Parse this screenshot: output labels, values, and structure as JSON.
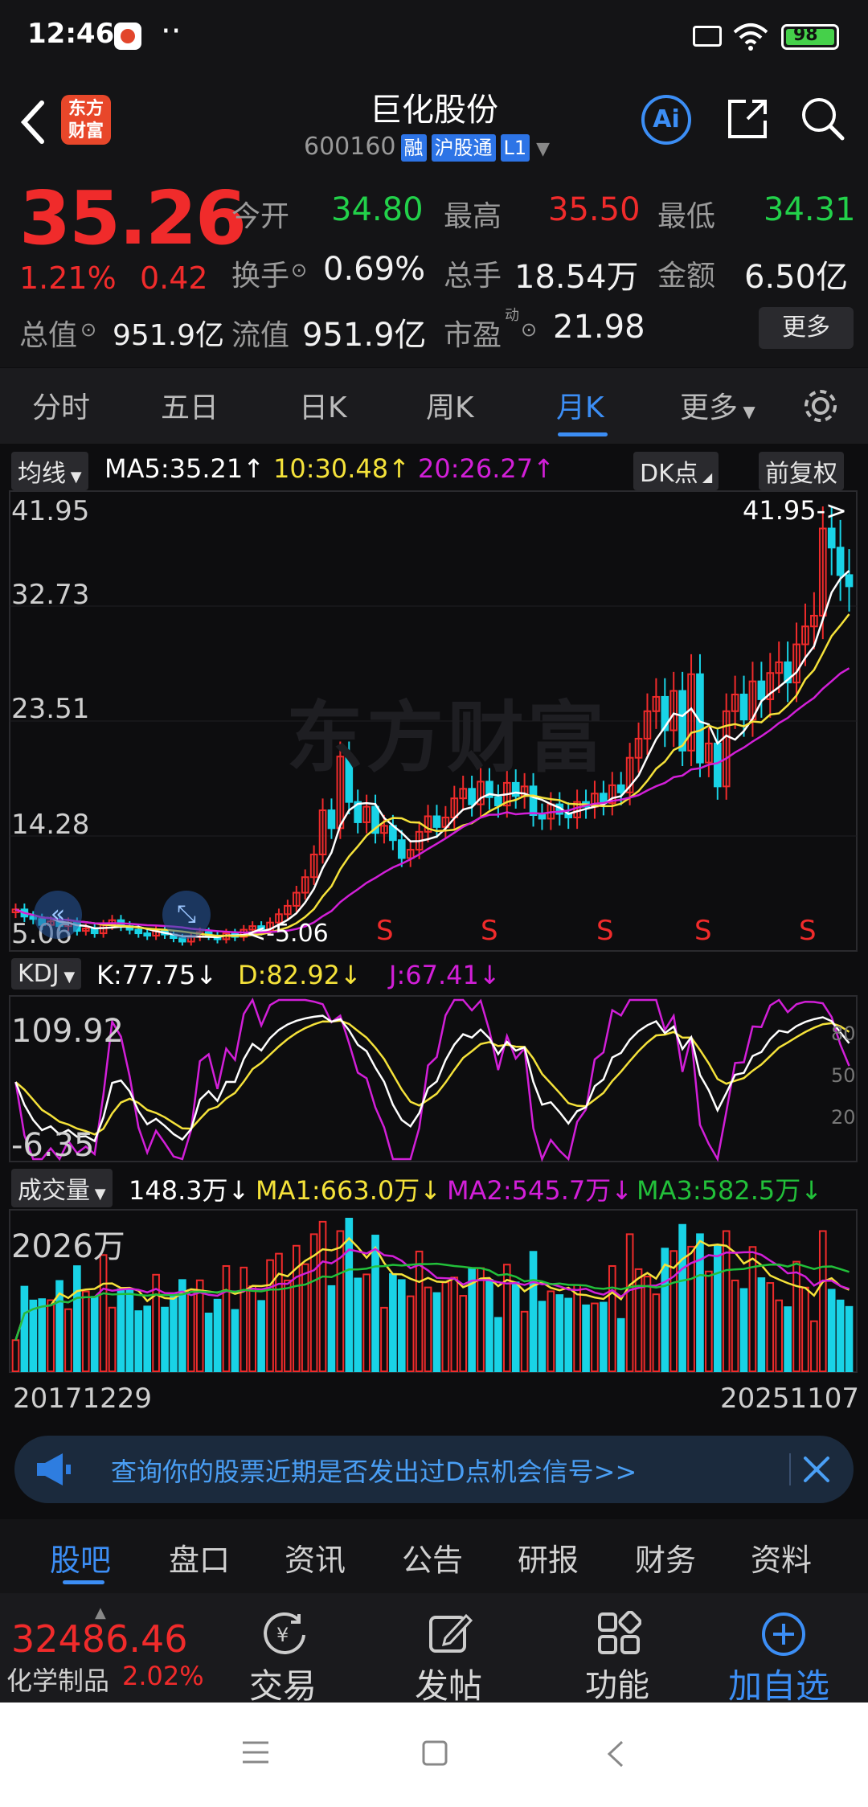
{
  "status_bar": {
    "time": "12:46",
    "dots": "··",
    "battery": "98"
  },
  "header": {
    "title": "巨化股份",
    "code": "600160",
    "tags": [
      "融",
      "沪股通",
      "L1"
    ],
    "logo_text_1": "东方",
    "logo_text_2": "财富",
    "ai_label": "Ai"
  },
  "quote": {
    "price": "35.26",
    "change_pct": "1.21%",
    "change": "0.42",
    "rows": [
      [
        {
          "label": "今开",
          "value": "34.80",
          "color": "#22d14a"
        },
        {
          "label": "最高",
          "value": "35.50",
          "color": "#f02b2b"
        },
        {
          "label": "最低",
          "value": "34.31",
          "color": "#22d14a"
        }
      ],
      [
        {
          "label": "换手",
          "value": "0.69%",
          "color": "#f2f2f2"
        },
        {
          "label": "总手",
          "value": "18.54万",
          "color": "#f2f2f2"
        },
        {
          "label": "金额",
          "value": "6.50亿",
          "color": "#f2f2f2"
        }
      ]
    ],
    "zongzhi_label": "总值",
    "zongzhi": "951.9亿",
    "liuzhi_label": "流值",
    "liuzhi": "951.9亿",
    "shiying_label": "市盈",
    "shiying_sup": "动",
    "shiying": "21.98",
    "more": "更多"
  },
  "tabs": [
    "分时",
    "五日",
    "日K",
    "周K",
    "月K",
    "更多"
  ],
  "active_tab": "月K",
  "ma_bar": {
    "selector": "均线",
    "ma5": "MA5:35.21",
    "ma10": "10:30.48",
    "ma20": "20:26.27",
    "dk": "DK点",
    "fuquan": "前复权"
  },
  "kline_axis": [
    "41.95",
    "32.73",
    "23.51",
    "14.28",
    "5.06"
  ],
  "kline_marks": {
    "high": "41.95->",
    "low": "<-5.06",
    "s": [
      "S",
      "S",
      "S",
      "S",
      "S"
    ]
  },
  "watermark": "东方财富",
  "kdj_bar": {
    "selector": "KDJ",
    "k": "K:77.75",
    "d": "D:82.92",
    "j": "J:67.41"
  },
  "kdj_axis": {
    "top": "109.92",
    "bottom": "-6.35",
    "r80": "80",
    "r50": "50",
    "r20": "20"
  },
  "vol_bar": {
    "selector": "成交量",
    "v": "148.3万",
    "ma1": "MA1:663.0万",
    "ma2": "MA2:545.7万",
    "ma3": "MA3:582.5万"
  },
  "vol_axis": {
    "top": "2026万"
  },
  "dates": {
    "start": "20171229",
    "end": "20251107"
  },
  "colors": {
    "up": "#f02b2b",
    "down": "#19d3e6",
    "ma5": "#ffffff",
    "ma10": "#f5e23a",
    "ma20": "#d21fd8",
    "accent": "#3c8ef5",
    "ma3": "#22c03a"
  },
  "banner": {
    "text": "查询你的股票近期是否发出过D点机会信号>>"
  },
  "bottom_tabs": [
    "股吧",
    "盘口",
    "资讯",
    "公告",
    "研报",
    "财务",
    "资料"
  ],
  "toolbar": {
    "index_value": "32486.46",
    "index_name": "化学制品",
    "index_pct": "2.02%",
    "trade": "交易",
    "post": "发帖",
    "func": "功能",
    "add": "加自选"
  },
  "chart_data": {
    "type": "candlestick",
    "period": "monthly",
    "x_range": [
      "20171229",
      "20251107"
    ],
    "ylim": [
      5.06,
      41.95
    ],
    "closes": [
      8.2,
      7.6,
      7.4,
      6.9,
      7.2,
      6.8,
      7.1,
      6.4,
      6.6,
      6.2,
      6.9,
      7.3,
      6.8,
      6.5,
      6.2,
      6.0,
      6.4,
      6.1,
      5.8,
      5.5,
      5.9,
      6.3,
      6.0,
      5.7,
      6.2,
      5.9,
      6.5,
      6.8,
      6.4,
      7.1,
      7.8,
      8.5,
      9.6,
      10.9,
      12.8,
      16.5,
      15.0,
      21.0,
      17.2,
      15.5,
      16.8,
      14.6,
      15.2,
      14.0,
      12.5,
      13.2,
      14.7,
      16.0,
      15.1,
      15.9,
      17.5,
      18.3,
      17.0,
      18.9,
      17.6,
      16.9,
      18.8,
      17.7,
      18.5,
      16.1,
      15.8,
      17.0,
      16.2,
      15.9,
      17.2,
      16.8,
      17.9,
      17.1,
      18.6,
      18.0,
      20.9,
      22.5,
      24.8,
      26.0,
      23.2,
      26.5,
      21.5,
      27.9,
      20.5,
      22.1,
      18.5,
      24.8,
      26.2,
      24.1,
      27.3,
      25.8,
      28.0,
      28.9,
      27.2,
      30.4,
      31.9,
      32.8,
      40.1,
      38.5,
      36.2,
      35.26
    ],
    "ma5_last": 35.21,
    "ma10_last": 30.48,
    "ma20_last": 26.27,
    "kdj": {
      "k_last": 77.75,
      "d_last": 82.92,
      "j_last": 67.41,
      "ylim": [
        -6.35,
        109.92
      ]
    },
    "volume": {
      "max": "2026万",
      "last": "148.3万",
      "ma1": "663.0万",
      "ma2": "545.7万",
      "ma3": "582.5万"
    }
  }
}
